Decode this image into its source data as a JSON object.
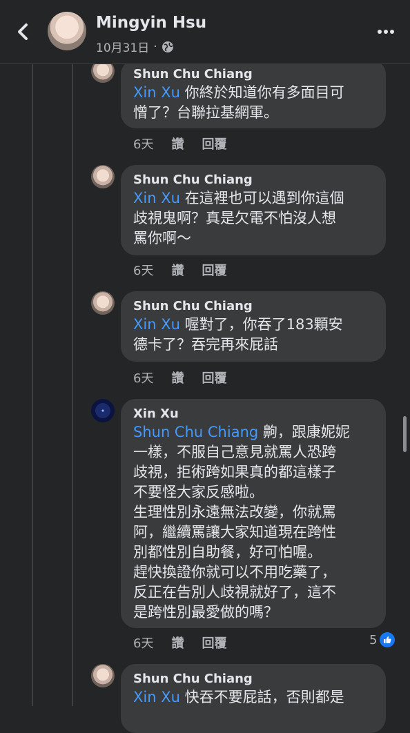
{
  "header": {
    "name": "Mingyin Hsu",
    "date": "10月31日",
    "separator": "·"
  },
  "comments": [
    {
      "author": "Shun Chu Chiang",
      "mention": "Xin Xu",
      "text": "你終於知道你有多面目可\n憎了？台聯拉基網軍。",
      "time": "6天",
      "like": "讚",
      "reply": "回覆"
    },
    {
      "author": "Shun Chu Chiang",
      "mention": "Xin Xu",
      "text": "在這裡也可以遇到你這個\n歧視鬼啊？真是欠電不怕沒人想\n罵你啊～",
      "time": "6天",
      "like": "讚",
      "reply": "回覆"
    },
    {
      "author": "Shun Chu Chiang",
      "mention": "Xin Xu",
      "text": "喔對了，你吞了183顆安\n德卡了？吞完再來屁話",
      "time": "6天",
      "like": "讚",
      "reply": "回覆"
    },
    {
      "author": "Xin Xu",
      "mention": "Shun Chu Chiang",
      "text": "齁，跟康妮妮\n一樣，不服自己意見就罵人恐跨\n歧視，拒術跨如果真的都這樣子\n不要怪大家反感啦。\n生理性別永遠無法改變，你就罵\n阿，繼續罵讓大家知道現在跨性\n別都性別自助餐，好可怕喔。\n趕快換證你就可以不用吃藥了，\n反正在告別人歧視就好了，這不\n是跨性別最愛做的嗎？",
      "time": "6天",
      "like": "讚",
      "reply": "回覆",
      "reaction_count": "5"
    },
    {
      "author": "Shun Chu Chiang",
      "mention": "Xin Xu",
      "text": "快吞不要屁話，否則都是"
    }
  ]
}
